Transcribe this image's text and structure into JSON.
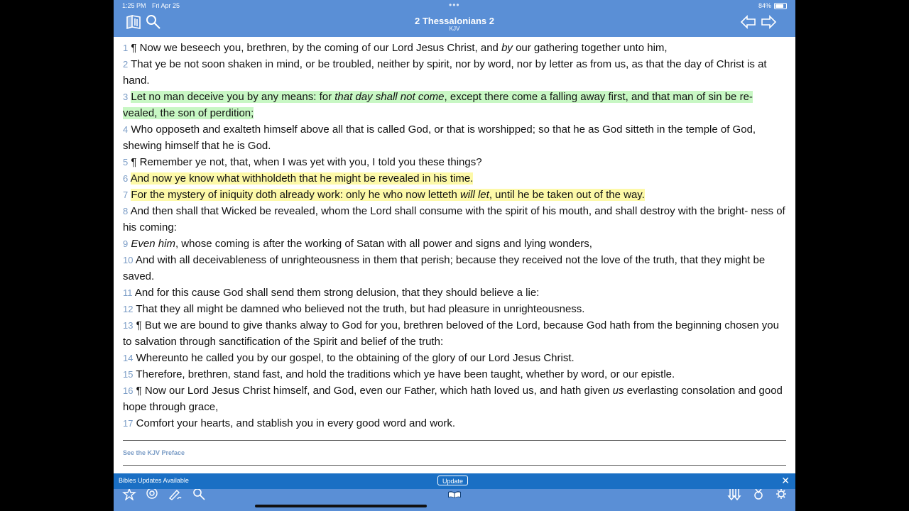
{
  "status": {
    "time": "1:25 PM",
    "date": "Fri Apr 25",
    "battery": "84%"
  },
  "header": {
    "title": "2 Thessalonians 2",
    "subtitle": "KJV"
  },
  "icons": {
    "library": "book-icon",
    "search": "search-icon",
    "back": "arrow-back-icon",
    "forward": "arrow-forward-icon"
  },
  "verses": [
    {
      "num": "1",
      "html": "¶ Now we beseech you, brethren, by the coming of our Lord Jesus Christ, and <i>by</i> our gathering together unto him,"
    },
    {
      "num": "2",
      "html": "That ye be not soon shaken in mind, or be troubled, neither by spirit, nor by word, nor by letter as from us, as that the day of Christ is at hand."
    },
    {
      "num": "3",
      "html": "Let no man deceive you by any means: for <i>that day shall not come</i>, except there come a falling away first, and that man of sin be re- vealed, the son of perdition;",
      "highlight": "green"
    },
    {
      "num": "4",
      "html": "Who opposeth and exalteth himself above all that is called God, or that is worshipped; so that he as God sitteth in the temple of God, shewing himself that he is God."
    },
    {
      "num": "5",
      "html": "¶ Remember ye not, that, when I was yet with you, I told you these things?"
    },
    {
      "num": "6",
      "html": "And now ye know what withholdeth that he might be revealed in his time.",
      "highlight": "yellow"
    },
    {
      "num": "7",
      "html": "For the mystery of iniquity doth already work: only he who now letteth <i>will let</i>, until he be taken out of the way.",
      "highlight": "yellow"
    },
    {
      "num": "8",
      "html": "And then shall that Wicked be revealed, whom the Lord shall consume with the spirit of his mouth, and shall destroy with the bright- ness of his coming:"
    },
    {
      "num": "9",
      "html": "<i>Even him</i>, whose coming is after the working of Satan with all power and signs and lying wonders,"
    },
    {
      "num": "10",
      "html": "And with all deceivableness of unrighteousness in them that perish; because they received not the love of the truth, that they might be saved."
    },
    {
      "num": "11",
      "html": "And for this cause God shall send them strong delusion, that they should believe a lie:"
    },
    {
      "num": "12",
      "html": "That they all might be damned who believed not the truth, but had pleasure in unrighteousness."
    },
    {
      "num": "13",
      "html": "¶ But we are bound to give thanks alway to God for you, brethren beloved of the Lord, because God hath from the beginning chosen you to salvation through sanctification of the Spirit and belief of the truth:"
    },
    {
      "num": "14",
      "html": "Whereunto he called you by our gospel, to the obtaining of the glory of our Lord Jesus Christ."
    },
    {
      "num": "15",
      "html": "Therefore, brethren, stand fast, and hold the traditions which ye have been taught, whether by word, or our epistle."
    },
    {
      "num": "16",
      "html": "¶ Now our Lord Jesus Christ himself, and God, even our Father, which hath loved us, and hath given <i>us</i> everlasting consolation and good hope through grace,"
    },
    {
      "num": "17",
      "html": "Comfort your hearts, and stablish you in every good word and work."
    }
  ],
  "footer": {
    "preface_link": "See the KJV Preface"
  },
  "banner": {
    "text": "Bibles Updates Available",
    "button": "Update"
  },
  "colors": {
    "bar": "#5a8fd6",
    "banner": "#1a6fc4",
    "highlight_green": "#c8f7c4",
    "highlight_yellow": "#fdf9a8",
    "verse_number": "#7a9cc6"
  }
}
